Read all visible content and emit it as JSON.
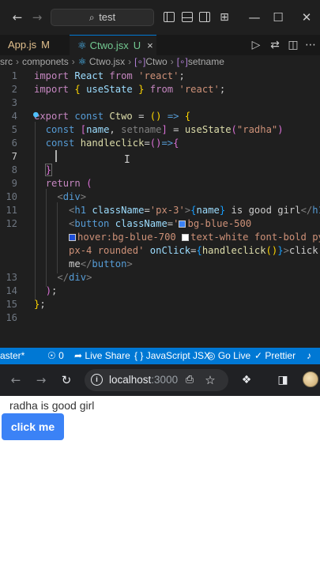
{
  "titlebar": {
    "search_text": "test",
    "search_icon": "search-icon",
    "back_icon": "←",
    "forward_icon": "→",
    "minimize_icon": "—",
    "maximize_icon": "☐",
    "close_icon": "✕"
  },
  "tabs": [
    {
      "label": "App.js",
      "status": "M",
      "active": false
    },
    {
      "label": "Ctwo.jsx",
      "status": "U",
      "active": true
    }
  ],
  "tab_close": "×",
  "breadcrumb": [
    "src",
    "componets",
    "Ctwo.jsx",
    "Ctwo",
    "setname"
  ],
  "editor": {
    "line_numbers": [
      "1",
      "2",
      "3",
      "4",
      "5",
      "6",
      "7",
      "8",
      "9",
      "10",
      "11",
      "12",
      "13",
      "14",
      "15",
      "16"
    ]
  },
  "statusbar": {
    "branch": "aster*",
    "ports": "0",
    "live_share": "Live Share",
    "language": "JavaScript JSX",
    "go_live": "Go Live",
    "prettier": "Prettier"
  },
  "browser": {
    "url_host": "localhost",
    "url_port": ":3000"
  },
  "page": {
    "heading": "radha is good girl",
    "button_label": "click me"
  },
  "colors": {
    "status_bar": "#0078d4",
    "tailwind_blue_500": "#3b82f6",
    "tailwind_blue_700": "#1d4ed8"
  }
}
